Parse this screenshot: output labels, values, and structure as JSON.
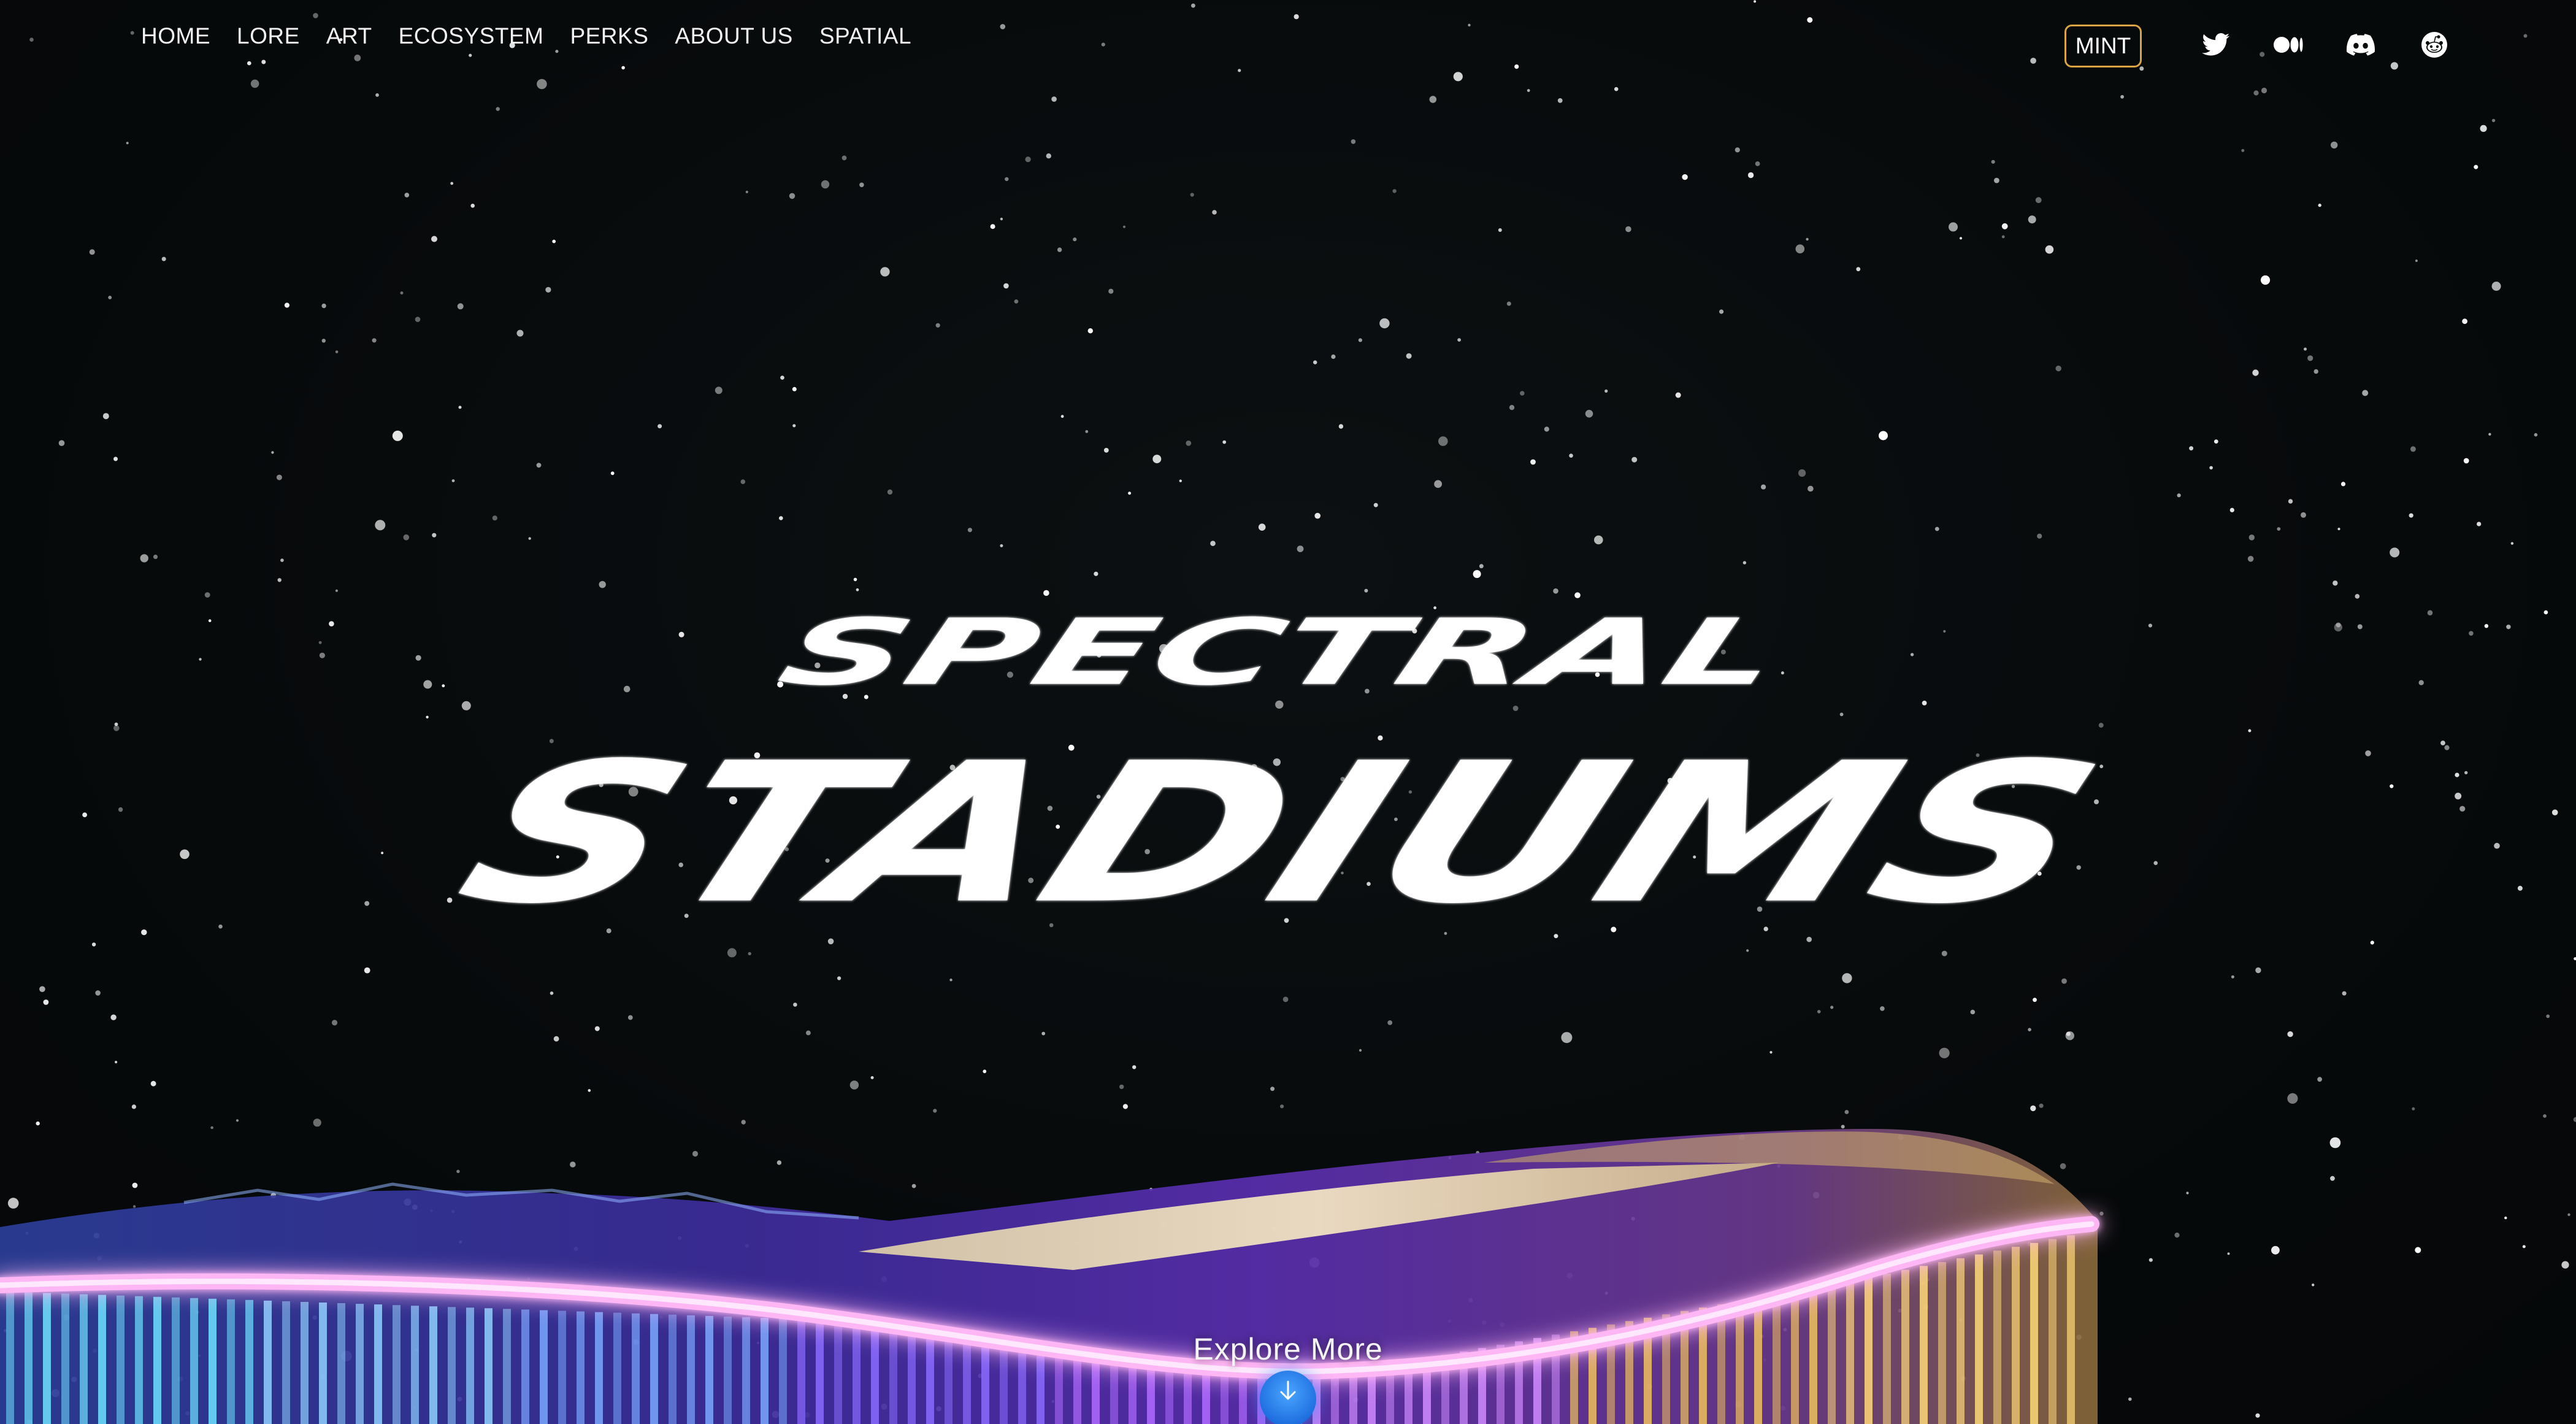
{
  "nav": {
    "items": [
      {
        "label": "HOME"
      },
      {
        "label": "LORE"
      },
      {
        "label": "ART"
      },
      {
        "label": "ECOSYSTEM"
      },
      {
        "label": "PERKS"
      },
      {
        "label": "ABOUT US"
      },
      {
        "label": "SPATIAL"
      }
    ]
  },
  "actions": {
    "mint_label": "MINT",
    "mint_border_color": "#d9a441"
  },
  "social": [
    {
      "name": "twitter",
      "icon": "twitter-bird-icon"
    },
    {
      "name": "medium",
      "icon": "medium-icon"
    },
    {
      "name": "discord",
      "icon": "discord-icon"
    },
    {
      "name": "reddit",
      "icon": "reddit-icon"
    }
  ],
  "hero": {
    "title_line1": "SPECTRAL",
    "title_line2": "STADIUMS",
    "title_color": "#ffffff"
  },
  "explore": {
    "label": "Explore More",
    "icon": "arrow-down-icon",
    "button_color": "#2a85f0"
  },
  "theme": {
    "background": "#070a0b",
    "neon_pink": "#ff7ff0",
    "neon_purple": "#a63cff",
    "neon_cyan": "#5fd8ff",
    "neon_gold": "#f2c04a"
  }
}
